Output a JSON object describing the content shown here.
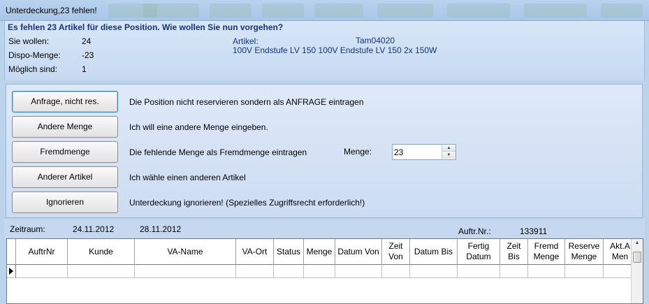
{
  "window": {
    "title": "Unterdeckung,23 fehlen!"
  },
  "info": {
    "heading": "Es fehlen 23 Artikel für diese Position. Wie wollen Sie nun vorgehen?",
    "sie_wollen_label": "Sie wollen:",
    "sie_wollen_value": "24",
    "dispo_label": "Dispo-Menge:",
    "dispo_value": "-23",
    "moeglich_label": "Möglich sind:",
    "moeglich_value": "1",
    "artikel_label": "Artikel:",
    "artikel_nr": "Tam04020",
    "artikel_desc": "100V Endstufe LV 150 100V Endstufe LV 150 2x 150W"
  },
  "options": [
    {
      "label": "Anfrage, nicht res.",
      "description": "Die Position nicht reservieren sondern als ANFRAGE eintragen"
    },
    {
      "label": "Andere Menge",
      "description": "Ich will eine andere Menge eingeben."
    },
    {
      "label": "Fremdmenge",
      "description": "Die fehlende Menge als Fremdmenge eintragen"
    },
    {
      "label": "Anderer Artikel",
      "description": "Ich wähle einen anderen Artikel"
    },
    {
      "label": "Ignorieren",
      "description": "Unterdeckung ignorieren! (Spezielles Zugriffsrecht erforderlich!)"
    }
  ],
  "menge": {
    "label": "Menge:",
    "value": "23"
  },
  "zeitraum": {
    "label": "Zeitraum:",
    "from": "24.11.2012",
    "to": "28.11.2012",
    "auftr_label": "Auftr.Nr.:",
    "auftr_value": "133911"
  },
  "grid": {
    "columns": [
      "AuftrNr",
      "Kunde",
      "VA-Name",
      "VA-Ort",
      "Status",
      "Menge",
      "Datum Von",
      "Zeit Von",
      "Datum Bis",
      "Fertig Datum",
      "Zeit Bis",
      "Fremd Menge",
      "Reserve Menge",
      "Akt.A Men"
    ]
  },
  "colors": {
    "heading": "#14337e",
    "panel": "#c6daf2",
    "focus": "#3c7fb1"
  },
  "icons": {
    "row_indicator": "current-row-arrow-icon",
    "scroll_up": "chevron-up-icon",
    "spin_up": "spin-up-icon",
    "spin_down": "spin-down-icon"
  }
}
